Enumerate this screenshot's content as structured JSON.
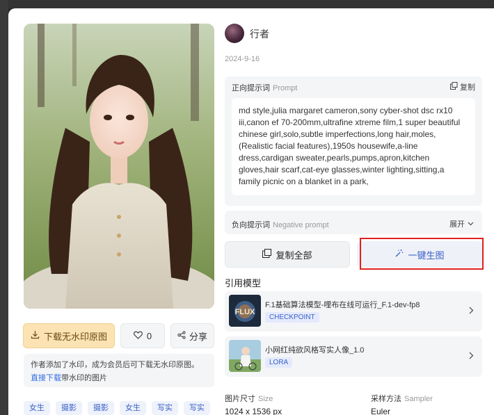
{
  "author": {
    "name": "行者"
  },
  "date": "2024-9-16",
  "prompt": {
    "label_cn": "正向提示词",
    "label_en": "Prompt",
    "copy_label": "复制",
    "text": "md style,julia margaret cameron,sony cyber-shot dsc rx10 iii,canon ef 70-200mm,ultrafine xtreme film,1 super beautiful chinese girl,solo,subtle imperfections,long hair,moles,(Realistic facial features),1950s housewife,a-line dress,cardigan sweater,pearls,pumps,apron,kitchen gloves,hair scarf,cat-eye glasses,winter lighting,sitting,a family picnic on a blanket in a park,"
  },
  "negative": {
    "label_cn": "负向提示词",
    "label_en": "Negative prompt",
    "expand_label": "展开"
  },
  "actions": {
    "copy_all": "复制全部",
    "generate": "一键生图",
    "download": "下载无水印原图",
    "like_count": "0",
    "share": "分享"
  },
  "notice": {
    "line1": "作者添加了水印，成为会员后可下载无水印原图。",
    "link": "直接下载",
    "line2_rest": "带水印的图片"
  },
  "tags": [
    "女生",
    "摄影",
    "摄影",
    "女生",
    "写实",
    "写实"
  ],
  "models_title": "引用模型",
  "models": [
    {
      "name": "F.1基础算法模型-哩布在线可运行_F.1-dev-fp8",
      "tag": "CHECKPOINT",
      "thumb_text": "FLUX"
    },
    {
      "name": "小网红纯欲风格写实人像_1.0",
      "tag": "LORA"
    }
  ],
  "meta": {
    "size_label_cn": "图片尺寸",
    "size_label_en": "Size",
    "size_value": "1024 x 1536 px",
    "sampler_label_cn": "采样方法",
    "sampler_label_en": "Sampler",
    "sampler_value": "Euler"
  },
  "colors": {
    "accent": "#3b61c8",
    "download_bg": "#fbe3b4",
    "highlight": "#e0201c"
  }
}
